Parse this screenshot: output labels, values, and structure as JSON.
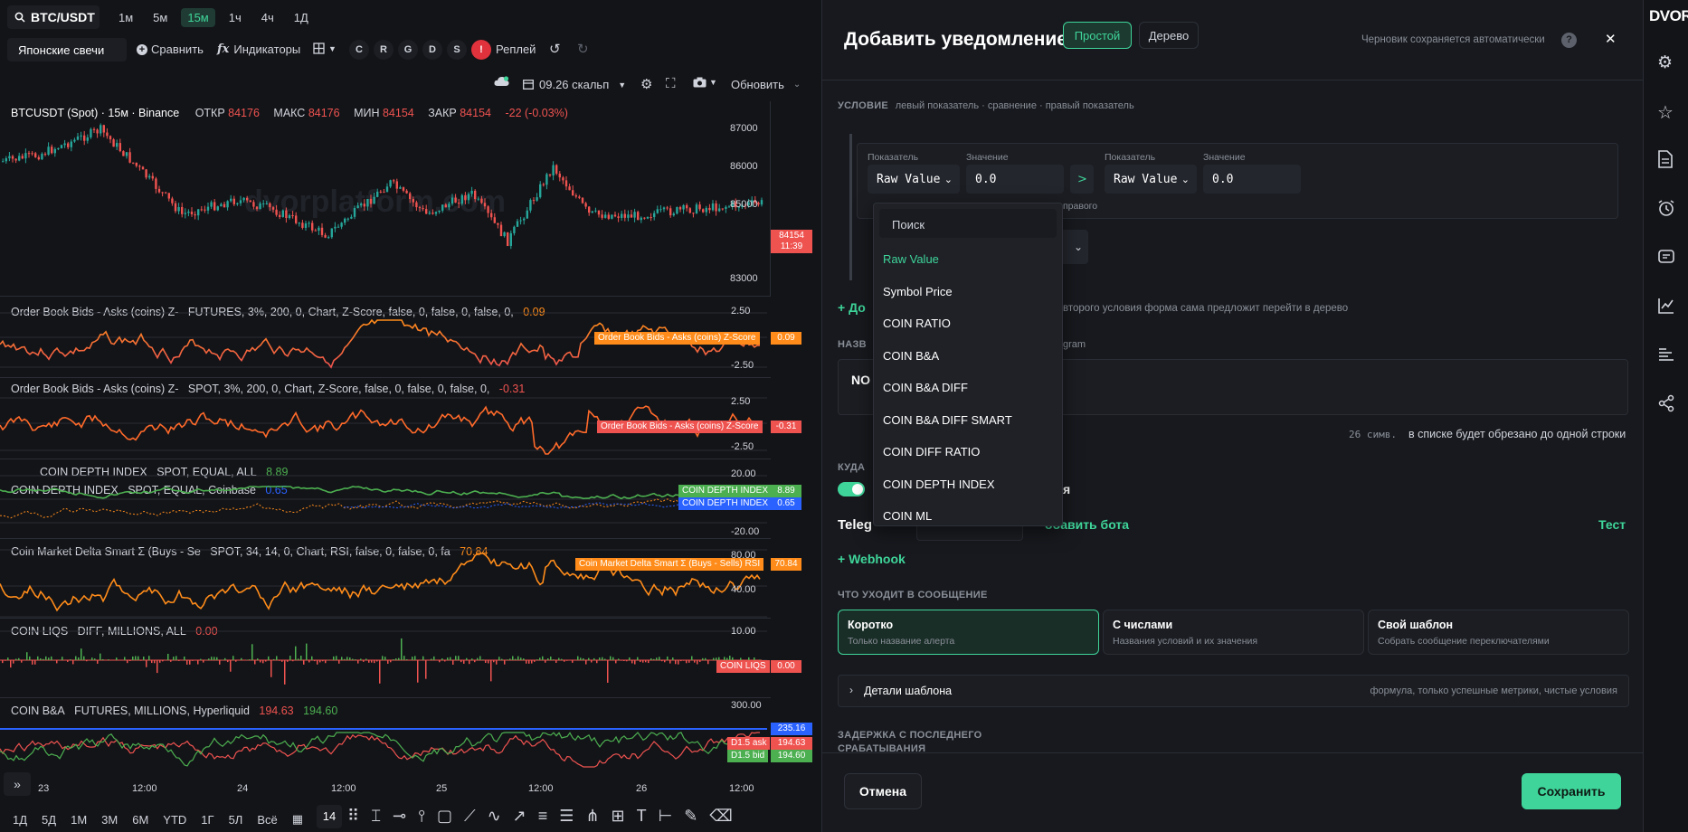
{
  "toolbar": {
    "symbol": "BTC/USDT",
    "timeframes": [
      "1м",
      "5м",
      "15м",
      "1ч",
      "4ч",
      "1Д"
    ],
    "active_tf": "15м",
    "chart_type": "Японские свечи",
    "compare": "Сравнить",
    "indicators": "Индикаторы",
    "circles": [
      "C",
      "R",
      "G",
      "D",
      "S",
      "!"
    ],
    "replay": "Реплей",
    "layout_name": "09.26 скальп",
    "update": "Обновить"
  },
  "chart": {
    "header": "BTCUSDT (Spot) · 15м · Binance",
    "open_label": "ОТКР",
    "open": "84176",
    "high_label": "МАКС",
    "high": "84176",
    "low_label": "МИН",
    "low": "84154",
    "close_label": "ЗАКР",
    "close": "84154",
    "change": "-22 (-0.03%)",
    "watermark": "dvorplatform.com",
    "price_ticks": [
      "87000",
      "86000",
      "85000",
      "84000",
      "83000"
    ],
    "price_tag": "84154",
    "price_timer": "11:39",
    "x_ticks": [
      "23",
      "12:00",
      "24",
      "12:00",
      "25",
      "12:00",
      "26",
      "12:00"
    ]
  },
  "panels": [
    {
      "label": "Order Book Bids - Asks (coins) Z-",
      "params": "FUTURES, 3%, 200, 0, Chart, Z-Score, false, 0, false, 0, false, 0,",
      "value": "0.09",
      "ticks": [
        "2.50",
        "-2.50"
      ],
      "tag": "Order Book Bids - Asks (coins) Z-Score",
      "tag_value": "0.09"
    },
    {
      "label": "Order Book Bids - Asks (coins) Z-",
      "params": "SPOT, 3%, 200, 0, Chart, Z-Score, false, 0, false, 0, false, 0,",
      "value": "-0.31",
      "ticks": [
        "2.50",
        "-2.50"
      ],
      "tag": "Order Book Bids - Asks (coins) Z-Score",
      "tag_value": "-0.31"
    },
    {
      "label": "COIN DEPTH INDEX",
      "params": "SPOT, EQUAL, ALL",
      "value": "8.89",
      "label2": "COIN DEPTH INDEX",
      "params2": "SPOT, EQUAL, Coinbase",
      "value2": "0.65",
      "ticks": [
        "20.00",
        "-20.00"
      ],
      "tag": "COIN DEPTH INDEX",
      "tag_value": "8.89",
      "tag2": "COIN DEPTH INDEX",
      "tag2_value": "0.65"
    },
    {
      "label": "Coin Market Delta Smart Σ (Buys - Se",
      "params": "SPOT, 34, 14, 0, Chart, RSI, false, 0, false, 0, fa",
      "value": "70.84",
      "ticks": [
        "80.00",
        "40.00"
      ],
      "tag": "Coin Market Delta Smart Σ (Buys - Sells) RSI",
      "tag_value": "70.84"
    },
    {
      "label": "COIN LIQS",
      "params": "DIFF, MILLIONS, ALL",
      "value": "0.00",
      "ticks": [
        "10.00",
        "-10.00"
      ],
      "tag": "COIN LIQS",
      "tag_value": "0.00"
    },
    {
      "label": "COIN B&A",
      "params": "FUTURES, MILLIONS, Hyperliquid",
      "value": "194.63",
      "value2": "194.60",
      "ticks": [
        "300.00"
      ],
      "tag_blue": "235.16",
      "tag": "D1.5 ask",
      "tag_value": "194.63",
      "tag2": "D1.5 bid",
      "tag2_value": "194.60"
    }
  ],
  "bottom_ranges": [
    "1Д",
    "5Д",
    "1М",
    "3М",
    "6М",
    "YTD",
    "1Г",
    "5Л",
    "Всё"
  ],
  "bottom_num": "14",
  "modal": {
    "title": "Добавить уведомление",
    "mode_simple": "Простой",
    "mode_tree": "Дерево",
    "autosave": "Черновик сохраняется автоматически",
    "condition_h": "УСЛОВИЕ",
    "condition_hint": "левый показатель · сравнение · правый показатель",
    "indicator_label": "Показатель",
    "value_label": "Значение",
    "left_indicator": "Raw Value",
    "left_value": "0.0",
    "operator": ">",
    "right_indicator": "Raw Value",
    "right_value": "0.0",
    "right_hint": "правого",
    "add_condition": "+ До",
    "tree_hint": "второго условия форма сама предложит перейти в дерево",
    "name_h": "НАЗВ",
    "telegram_hint": "gram",
    "name_value": "NO",
    "char_count": "26 симв.",
    "truncate_hint": "в списке будет обрезано до одной строки",
    "where_h": "КУДА",
    "toggle_tail": "я",
    "telegram": "Teleg",
    "add_bot": "обавить бота",
    "test": "Тест",
    "webhook": "+ Webhook",
    "message_h": "ЧТО УХОДИТ В СООБЩЕНИЕ",
    "cards": [
      {
        "title": "Коротко",
        "sub": "Только название алерта"
      },
      {
        "title": "С числами",
        "sub": "Названия условий и их значения"
      },
      {
        "title": "Свой шаблон",
        "sub": "Собрать сообщение переключателями"
      }
    ],
    "template_details": "Детали шаблона",
    "template_hint": "формула, только успешные метрики, чистые условия",
    "delay_h1": "ЗАДЕРЖКА С ПОСЛЕДНЕГО",
    "delay_h2": "СРАБАТЫВАНИЯ",
    "cancel": "Отмена",
    "save": "Сохранить"
  },
  "dropdown": {
    "search_placeholder": "Поиск",
    "items": [
      "Raw Value",
      "Symbol Price",
      "COIN RATIO",
      "COIN B&A",
      "COIN B&A DIFF",
      "COIN B&A DIFF SMART",
      "COIN DIFF RATIO",
      "COIN DEPTH INDEX",
      "COIN ML"
    ],
    "selected": "Raw Value"
  },
  "rail": {
    "logo": "DVOR"
  },
  "colors": {
    "accent": "#3fd59a",
    "up": "#26a69a",
    "down": "#ef5350",
    "orange": "#ff8c1a",
    "green_line": "#4caf50",
    "blue_line": "#2962ff"
  }
}
